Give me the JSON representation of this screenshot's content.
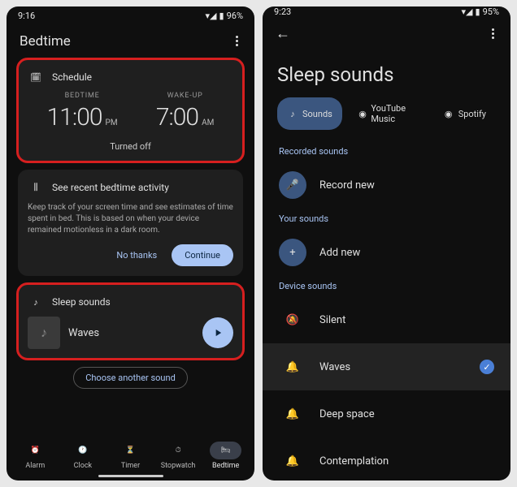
{
  "phone1": {
    "status": {
      "time": "9:16",
      "battery": "96%"
    },
    "title": "Bedtime",
    "schedule": {
      "heading": "Schedule",
      "bedtime_label": "BEDTIME",
      "bedtime_time": "11:00",
      "bedtime_ampm": "PM",
      "wakeup_label": "WAKE-UP",
      "wakeup_time": "7:00",
      "wakeup_ampm": "AM",
      "status": "Turned off"
    },
    "activity": {
      "heading": "See recent bedtime activity",
      "desc": "Keep track of your screen time and see estimates of time spent in bed. This is based on when your device remained motionless in a dark room.",
      "no_thanks": "No thanks",
      "continue": "Continue"
    },
    "sounds": {
      "heading": "Sleep sounds",
      "current": "Waves",
      "choose": "Choose another sound"
    },
    "tabs": [
      "Alarm",
      "Clock",
      "Timer",
      "Stopwatch",
      "Bedtime"
    ]
  },
  "phone2": {
    "status": {
      "time": "9:23",
      "battery": "95%"
    },
    "title": "Sleep sounds",
    "chips": [
      "Sounds",
      "YouTube Music",
      "Spotify"
    ],
    "sections": {
      "recorded": {
        "label": "Recorded sounds",
        "record_new": "Record new"
      },
      "your": {
        "label": "Your sounds",
        "add_new": "Add new"
      },
      "device": {
        "label": "Device sounds",
        "items": [
          "Silent",
          "Waves",
          "Deep space",
          "Contemplation"
        ],
        "selected": "Waves"
      }
    }
  }
}
